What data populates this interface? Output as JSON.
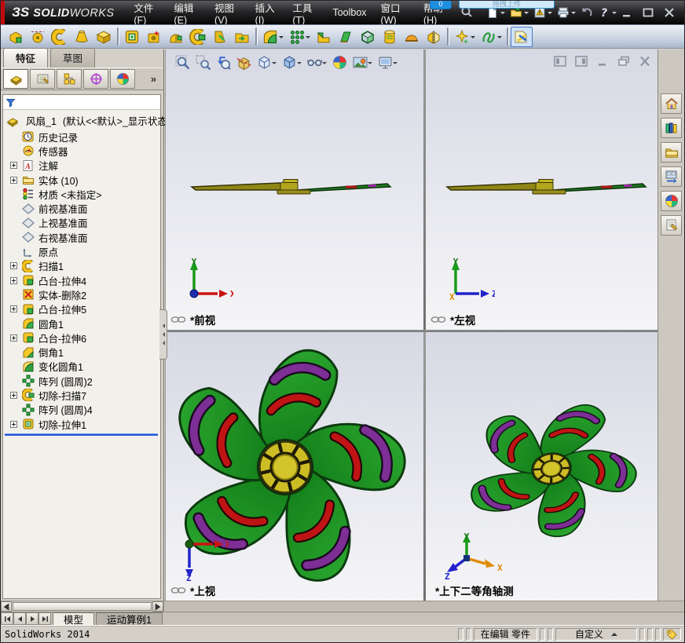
{
  "overlay": {
    "badge": "0",
    "bubble_text": "拖拽上传"
  },
  "title_bar": {
    "logo_mark": "ЗS",
    "logo_bold": "SOLID",
    "logo_light": "WORKS",
    "menus": [
      {
        "label": "文件(F)"
      },
      {
        "label": "编辑(E)"
      },
      {
        "label": "视图(V)"
      },
      {
        "label": "插入(I)"
      },
      {
        "label": "工具(T)"
      },
      {
        "label": "Toolbox"
      },
      {
        "label": "窗口(W)"
      },
      {
        "label": "帮助(H)"
      }
    ],
    "quick_access": [
      {
        "name": "new-document-button",
        "icon": "new-doc-icon",
        "caret": true
      },
      {
        "name": "open-button",
        "icon": "open-icon",
        "caret": true
      },
      {
        "name": "rebuild-button",
        "icon": "rebuild-icon",
        "caret": true
      },
      {
        "name": "print-button",
        "icon": "print-icon",
        "caret": true
      },
      {
        "name": "undo-button",
        "icon": "undo-icon",
        "caret": false
      },
      {
        "name": "help-button",
        "icon": "help-icon",
        "caret": true
      }
    ]
  },
  "feature_toolbar": {
    "icons": [
      {
        "name": "extruded-boss-button",
        "icon": "ft-extrude-icon"
      },
      {
        "name": "revolved-boss-button",
        "icon": "ft-revolve-icon"
      },
      {
        "name": "swept-boss-button",
        "icon": "sweep-icon"
      },
      {
        "name": "lofted-boss-button",
        "icon": "ft-loft-icon"
      },
      {
        "name": "boundary-boss-button",
        "icon": "ft-boundary-icon"
      },
      {
        "sep": true
      },
      {
        "name": "extruded-cut-button",
        "icon": "cut-extrude-icon"
      },
      {
        "name": "hole-wizard-button",
        "icon": "ft-hole-wizard-icon"
      },
      {
        "name": "revolved-cut-button",
        "icon": "ft-revolve-cut-icon"
      },
      {
        "name": "swept-cut-button",
        "icon": "cut-sweep-icon"
      },
      {
        "name": "lofted-cut-button",
        "icon": "ft-loft-cut-icon"
      },
      {
        "name": "boundary-cut-button",
        "icon": "ft-boundary-cut-icon"
      },
      {
        "sep": true
      },
      {
        "name": "fillet-button",
        "icon": "fillet-icon",
        "caret": true
      },
      {
        "name": "pattern-button",
        "icon": "pattern-grid-icon",
        "caret": true
      },
      {
        "name": "rib-button",
        "icon": "ft-rib-icon"
      },
      {
        "name": "draft-button",
        "icon": "ft-draft-icon"
      },
      {
        "name": "shell-button",
        "icon": "ft-shell-icon"
      },
      {
        "name": "wrap-button",
        "icon": "ft-wrap-icon"
      },
      {
        "name": "dome-button",
        "icon": "ft-dome-icon"
      },
      {
        "name": "mirror-button",
        "icon": "ft-mirror-icon"
      },
      {
        "sep": true
      },
      {
        "name": "reference-geometry-button",
        "icon": "sparkle-icon",
        "caret": true
      },
      {
        "name": "curves-button",
        "icon": "curve-icon",
        "caret": true
      },
      {
        "sep": true
      },
      {
        "name": "instant3d-button",
        "icon": "instant3d-icon",
        "pressed": true
      }
    ]
  },
  "left_panel": {
    "tabs": [
      {
        "label": "特征",
        "active": true
      },
      {
        "label": "草图",
        "active": false
      }
    ],
    "manager_tabs": [
      {
        "name": "featuremanager-tab",
        "icon": "part-icon",
        "active": true
      },
      {
        "name": "propertymanager-tab",
        "icon": "property-icon"
      },
      {
        "name": "configurationmanager-tab",
        "icon": "config-icon"
      },
      {
        "name": "dimxpertmanager-tab",
        "icon": "dimxpert-icon"
      },
      {
        "name": "displaymanager-tab",
        "icon": "color-ball-icon"
      }
    ],
    "overflow_label": "»",
    "tree": {
      "root_label": "风扇_1",
      "root_config": "(默认<<默认>_显示状态",
      "items": [
        {
          "label": "历史记录",
          "icon": "history-icon"
        },
        {
          "label": "传感器",
          "icon": "sensors-icon"
        },
        {
          "label": "注解",
          "icon": "annotation-icon",
          "expandable": true
        },
        {
          "label": "实体 (10)",
          "icon": "solid-folder-icon",
          "expandable": true
        },
        {
          "label": "材质 <未指定>",
          "icon": "material-icon"
        },
        {
          "label": "前视基准面",
          "icon": "plane-icon"
        },
        {
          "label": "上视基准面",
          "icon": "plane-icon"
        },
        {
          "label": "右视基准面",
          "icon": "plane-icon"
        },
        {
          "label": "原点",
          "icon": "origin-icon"
        },
        {
          "label": "扫描1",
          "icon": "sweep-icon",
          "expandable": true
        },
        {
          "label": "凸台-拉伸4",
          "icon": "boss-extrude-icon",
          "expandable": true
        },
        {
          "label": "实体-删除2",
          "icon": "body-delete-icon"
        },
        {
          "label": "凸台-拉伸5",
          "icon": "boss-extrude-icon",
          "expandable": true
        },
        {
          "label": "圆角1",
          "icon": "fillet-icon"
        },
        {
          "label": "凸台-拉伸6",
          "icon": "boss-extrude-icon",
          "expandable": true
        },
        {
          "label": "倒角1",
          "icon": "chamfer-icon"
        },
        {
          "label": "变化圆角1",
          "icon": "vary-fillet-icon"
        },
        {
          "label": "阵列 (圆周)2",
          "icon": "circular-pattern-icon"
        },
        {
          "label": "切除-扫描7",
          "icon": "cut-sweep-icon",
          "expandable": true
        },
        {
          "label": "阵列 (圆周)4",
          "icon": "circular-pattern-icon"
        },
        {
          "label": "切除-拉伸1",
          "icon": "cut-extrude-icon",
          "expandable": true
        }
      ]
    }
  },
  "headsup": {
    "icons": [
      {
        "name": "zoom-to-fit-button",
        "icon": "zoom-fit-icon"
      },
      {
        "name": "zoom-to-area-button",
        "icon": "zoom-area-icon"
      },
      {
        "name": "previous-view-button",
        "icon": "prev-view-icon"
      },
      {
        "name": "section-view-button",
        "icon": "section-icon"
      },
      {
        "name": "view-orientation-button",
        "icon": "orientation-icon",
        "caret": true
      },
      {
        "name": "display-style-button",
        "icon": "display-style-icon",
        "caret": true
      },
      {
        "name": "hide-show-items-button",
        "icon": "glasses-icon",
        "caret": true
      },
      {
        "name": "edit-appearance-button",
        "icon": "color-ball-icon"
      },
      {
        "name": "apply-scene-button",
        "icon": "scene-icon",
        "caret": true
      },
      {
        "name": "view-settings-button",
        "icon": "view-settings-icon",
        "caret": true
      }
    ]
  },
  "doc_controls": [
    {
      "name": "split-view-left-button",
      "icon": "split-left-icon"
    },
    {
      "name": "split-view-right-button",
      "icon": "split-right-icon"
    },
    {
      "name": "doc-minimize-button",
      "icon": "doc-min-icon"
    },
    {
      "name": "doc-restore-button",
      "icon": "doc-restore-icon"
    },
    {
      "name": "doc-close-button",
      "icon": "doc-close-icon"
    }
  ],
  "viewports": {
    "front": {
      "label": "*前视",
      "triad": {
        "v": "Y",
        "h": "X"
      }
    },
    "left": {
      "label": "*左视",
      "triad": {
        "v": "Y",
        "h": "Z",
        "o": "X"
      }
    },
    "top": {
      "label": "*上视",
      "triad": {
        "h": "X",
        "d": "Z"
      }
    },
    "iso": {
      "label": "*上下二等角轴测",
      "triad": {
        "v": "Y",
        "l": "Z",
        "r": "X"
      }
    }
  },
  "task_pane": [
    {
      "name": "solidworks-resources-tab",
      "icon": "home-icon"
    },
    {
      "name": "design-library-tab",
      "icon": "design-library-icon"
    },
    {
      "name": "file-explorer-tab",
      "icon": "folder-icon"
    },
    {
      "name": "view-palette-tab",
      "icon": "view-palette-icon"
    },
    {
      "name": "appearances-scenes-tab",
      "icon": "color-ball-icon"
    },
    {
      "name": "custom-properties-tab",
      "icon": "custom-props-icon"
    }
  ],
  "bottom": {
    "tabs": [
      {
        "label": "模型",
        "active": true
      },
      {
        "label": "运动算例1",
        "active": false
      }
    ]
  },
  "status_bar": {
    "app": "SolidWorks 2014",
    "editing": "在编辑 零件",
    "custom": "自定义"
  },
  "colors": {
    "blade_green": "#1f8f24",
    "slot_purple": "#7d2f96",
    "slot_red": "#c01414",
    "hub_yellow": "#cdbd25",
    "titlebar_dark": "#1c1c1e",
    "viewport_top": "#d6d8e3",
    "viewport_bottom": "#f5f5f7",
    "rollback_blue": "#2457d6"
  }
}
